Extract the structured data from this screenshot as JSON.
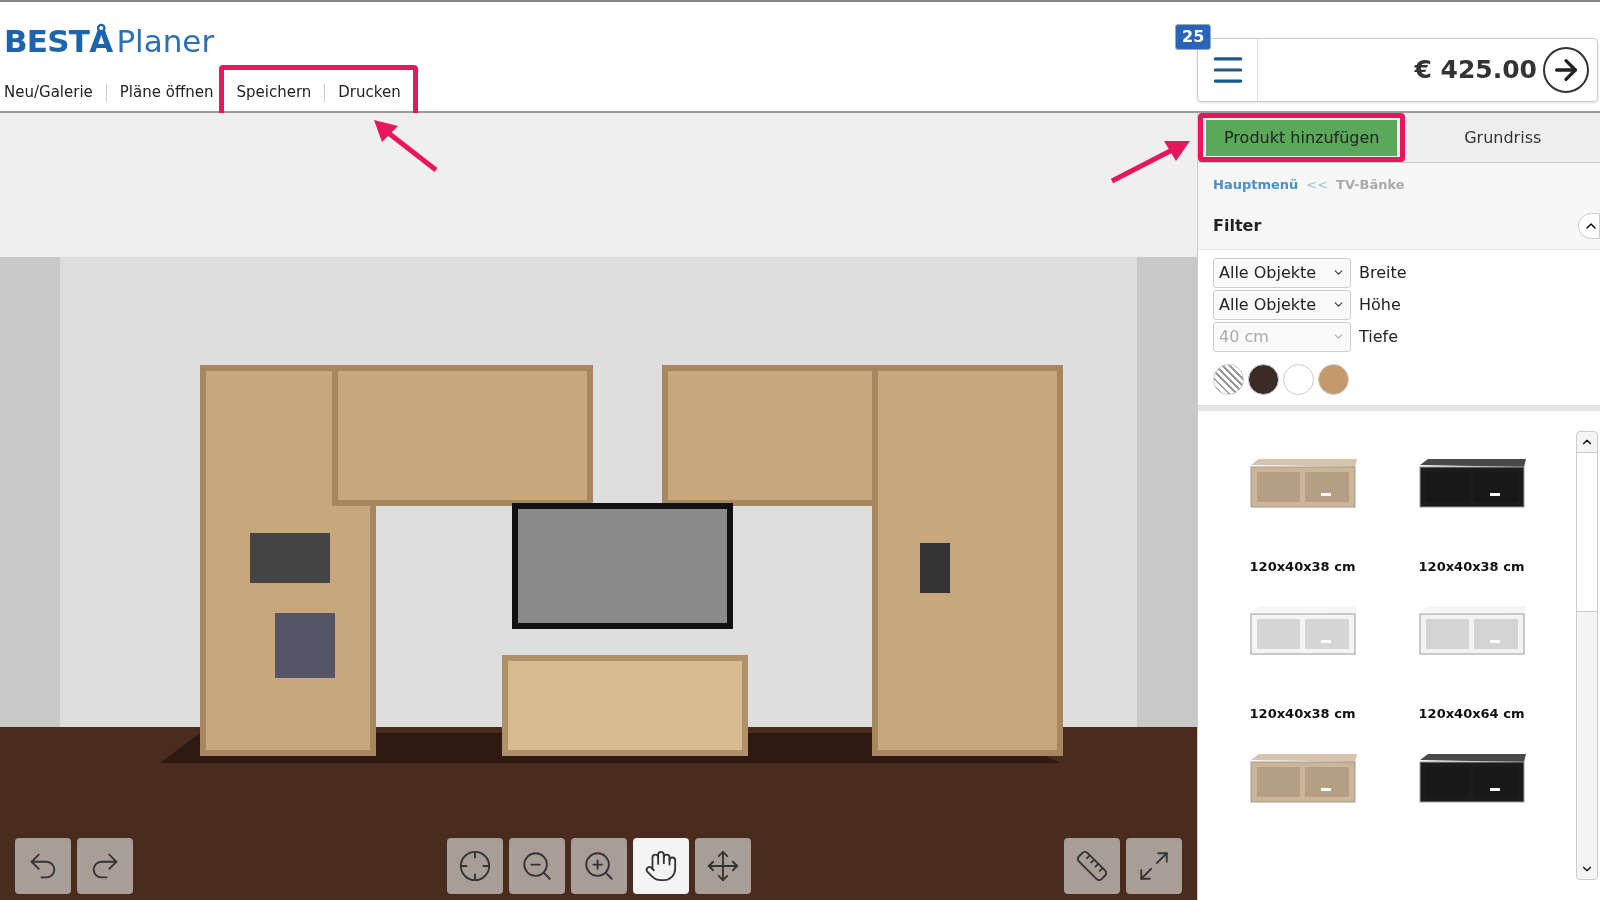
{
  "header": {
    "logo_bold": "BESTÅ",
    "logo_light": "Planer",
    "nav": [
      {
        "label": "Neu/Galerie",
        "highlighted": false
      },
      {
        "label": "Pläne öffnen",
        "highlighted": false
      },
      {
        "label": "Speichern",
        "highlighted": true
      },
      {
        "label": "Drucken",
        "highlighted": true
      }
    ]
  },
  "cart": {
    "badge": "25",
    "total": "€ 425.00"
  },
  "tabs": [
    {
      "label": "Produkt hinzufügen",
      "selected": true,
      "highlighted": true
    },
    {
      "label": "Grundriss",
      "selected": false,
      "highlighted": false
    }
  ],
  "breadcrumb": [
    {
      "label": "Hauptmenü",
      "kind": "link"
    },
    {
      "label": "<<",
      "kind": "separator"
    },
    {
      "label": "TV-Bänke",
      "kind": "current"
    }
  ],
  "filter": {
    "title": "Filter",
    "expanded": true,
    "fields": [
      {
        "value": "Alle Objekte",
        "label": "Breite",
        "disabled": false
      },
      {
        "value": "Alle Objekte",
        "label": "Höhe",
        "disabled": false
      },
      {
        "value": "40 cm",
        "label": "Tiefe",
        "disabled": true
      }
    ],
    "swatches": [
      {
        "kind": "pattern",
        "color": "#9a9a9a"
      },
      {
        "kind": "solid",
        "color": "#3a2b27"
      },
      {
        "kind": "solid",
        "color": "#ffffff"
      },
      {
        "kind": "solid",
        "color": "#c49a6c"
      }
    ]
  },
  "products": [
    {
      "size": "120x40x38 cm",
      "color": "#cdb597"
    },
    {
      "size": "120x40x38 cm",
      "color": "#1c1c1c"
    },
    {
      "size": "120x40x38 cm",
      "color": "#f4f4f4"
    },
    {
      "size": "120x40x64 cm",
      "color": "#f2f2f2"
    },
    {
      "color": "#cdb597"
    },
    {
      "color": "#1c1c1c"
    }
  ],
  "tools": [
    {
      "kind": "undo",
      "selected": false
    },
    {
      "kind": "redo",
      "selected": false
    },
    {
      "kind": "center",
      "selected": false
    },
    {
      "kind": "zoom-out",
      "selected": false
    },
    {
      "kind": "zoom-in",
      "selected": false
    },
    {
      "kind": "rotate",
      "selected": true
    },
    {
      "kind": "pan",
      "selected": false
    },
    {
      "kind": "measure",
      "selected": false
    },
    {
      "kind": "fullscreen",
      "selected": false
    }
  ]
}
